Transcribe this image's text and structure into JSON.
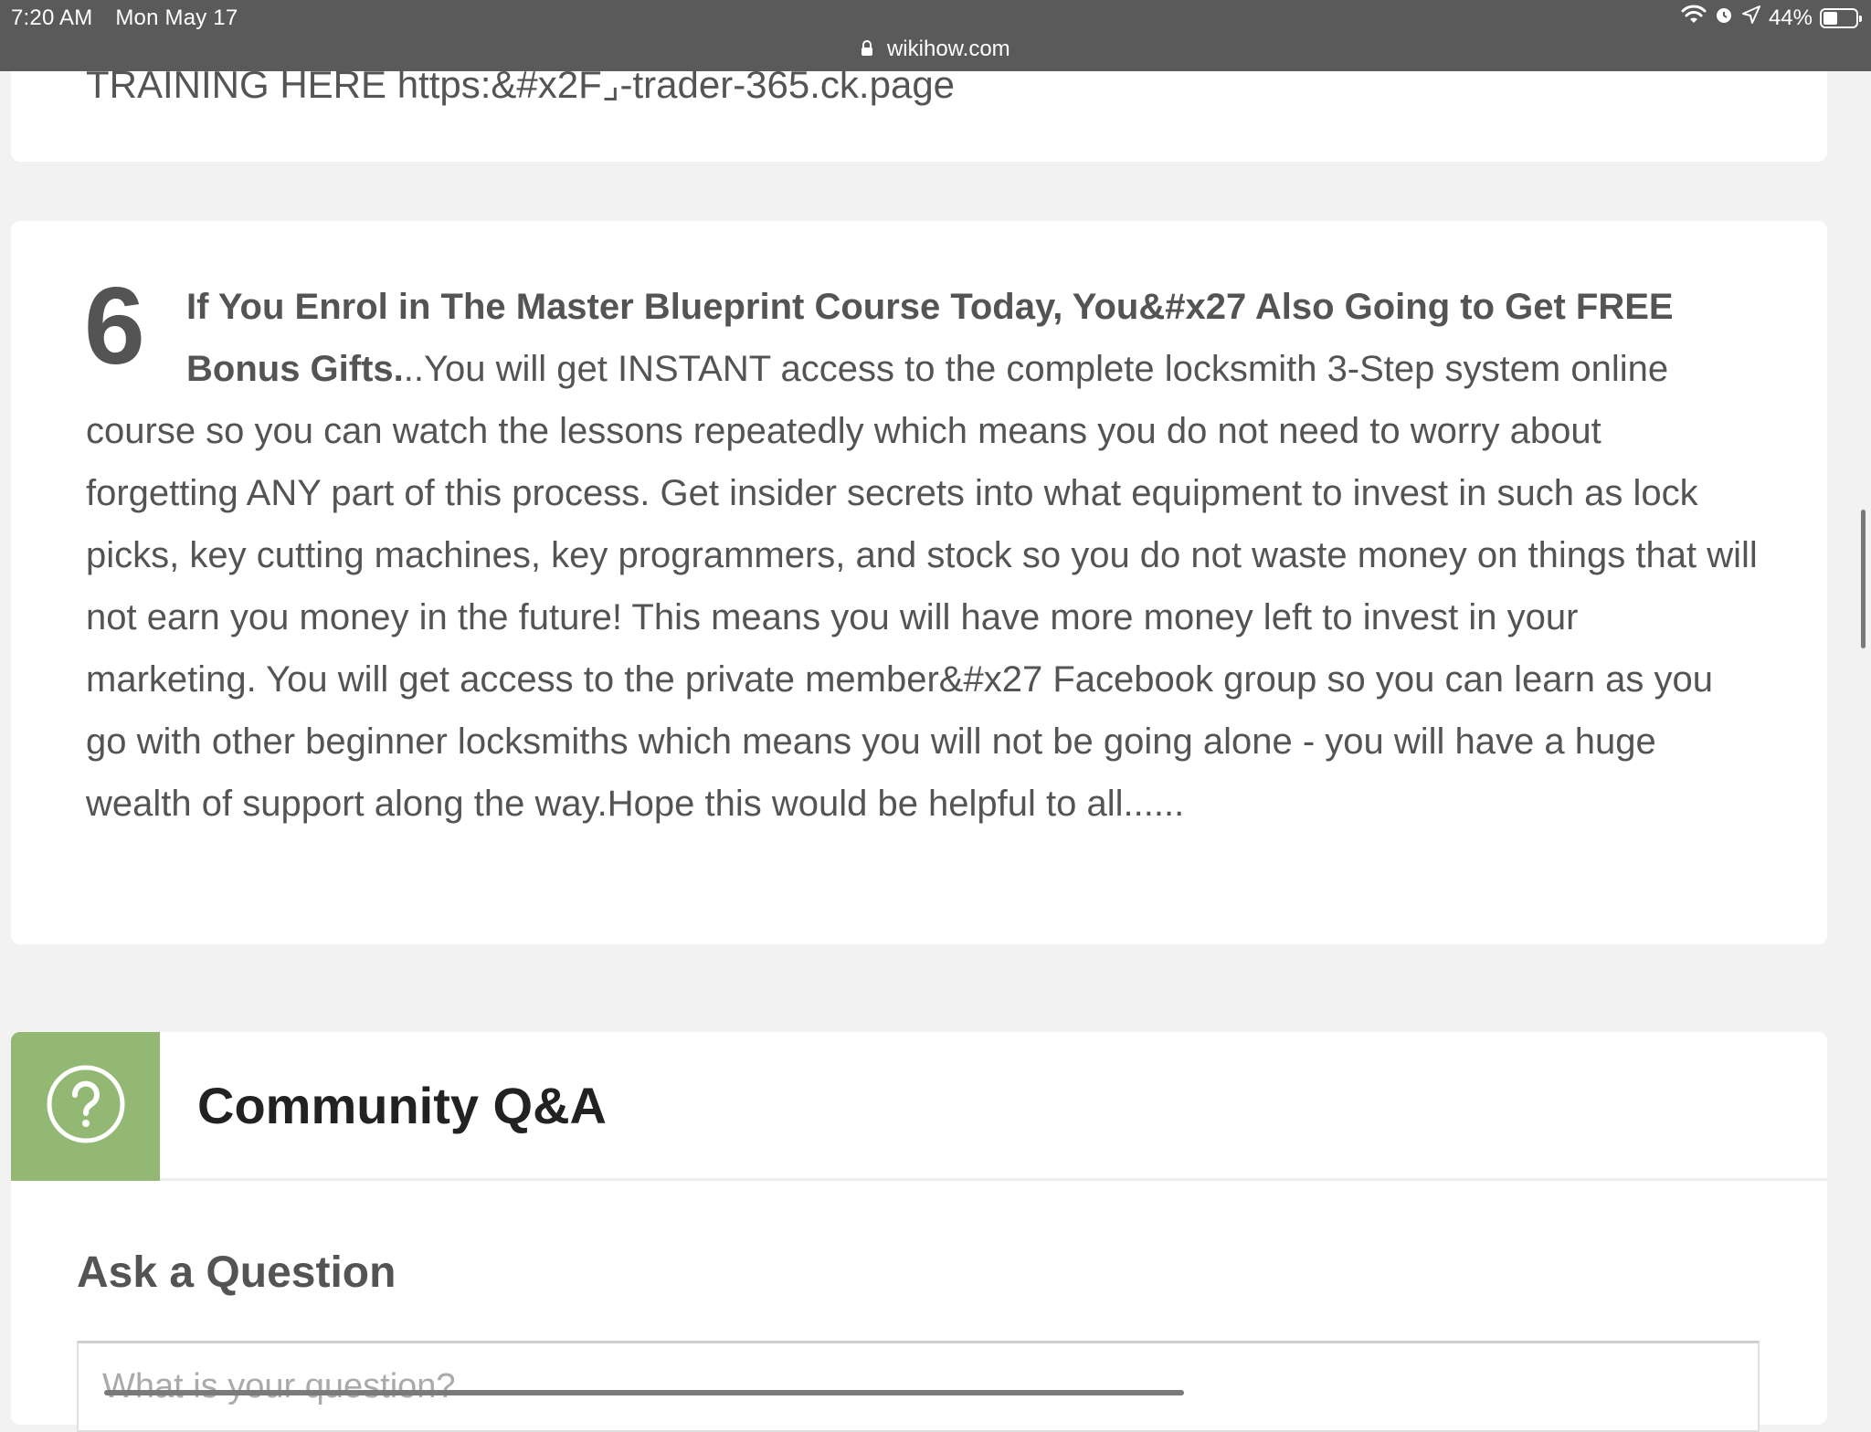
{
  "status_bar": {
    "time": "7:20 AM",
    "date": "Mon May 17",
    "battery": "44%",
    "url": "wikihow.com"
  },
  "previous_step": {
    "text": "TRAINING HERE https:&#x2F⌟-trader-365.ck.page"
  },
  "step": {
    "number": "6",
    "heading": "If You Enrol in The Master Blueprint Course Today, You&#x27 Also Going to Get FREE Bonus Gifts.",
    "body": "..You will get INSTANT access to the complete locksmith 3-Step system online course so you can watch the lessons repeatedly which means you do not need to worry about forgetting ANY part of this process. Get insider secrets into what equipment to invest in such as lock picks, key cutting machines, key programmers, and stock so you do not waste money on things that will not earn you money in the future! This means you will have more money left to invest in your marketing. You will get access to the private member&#x27 Facebook group so you can learn as you go with other beginner locksmiths which means you will not be going alone - you will have a huge wealth of support along the way.Hope this would be helpful to all......"
  },
  "community_qa": {
    "title": "Community Q&A",
    "ask_heading": "Ask a Question",
    "input_placeholder": "What is your question?"
  },
  "icons": {
    "lock": "lock-icon",
    "wifi": "wifi-icon",
    "alarm": "alarm-icon",
    "location": "location-arrow-icon",
    "battery": "battery-icon",
    "question": "question-circle-icon"
  },
  "colors": {
    "status_bar_bg": "#5a5a5a",
    "page_bg": "#f2f2f2",
    "qa_accent": "#93b874",
    "text": "#545454"
  }
}
